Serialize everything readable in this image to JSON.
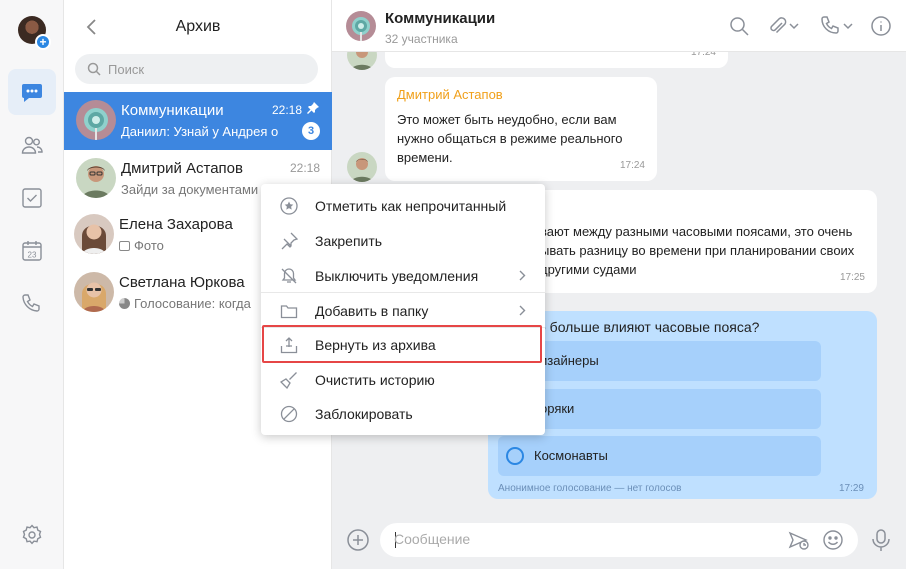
{
  "rail": {
    "items": [
      {
        "name": "chats",
        "icon": "chat-bubble-icon",
        "active": true
      },
      {
        "name": "contacts",
        "icon": "contacts-icon",
        "active": false
      },
      {
        "name": "tasks",
        "icon": "checkbox-icon",
        "active": false
      },
      {
        "name": "calendar",
        "icon": "calendar-icon",
        "calendar_day": "23",
        "active": false
      },
      {
        "name": "calls",
        "icon": "phone-icon",
        "active": false
      }
    ],
    "settings_icon": "gear-icon"
  },
  "list": {
    "title": "Архив",
    "search_placeholder": "Поиск",
    "chats": [
      {
        "name": "Коммуникации",
        "preview": "Даниил: Узнай у Андрея о",
        "time": "22:18",
        "badge": "3",
        "pinned": true,
        "selected": true
      },
      {
        "name": "Дмитрий Астапов",
        "preview": "Зайди за документами",
        "time": "22:18",
        "selected": false
      },
      {
        "name": "Елена Захарова",
        "preview": "Фото",
        "selected": false
      },
      {
        "name": "Светлана Юркова",
        "preview": "Голосование: когда",
        "selected": false
      }
    ]
  },
  "header": {
    "title": "Коммуникации",
    "subtitle": "32 участника"
  },
  "messages": {
    "m0_time": "17:24",
    "m1": {
      "author": "Дмитрий Астапов",
      "text": "Это может быть неудобно, если вам нужно общаться в режиме реального времени.",
      "time": "17:24"
    },
    "m2": {
      "text_l1": "вают между разными часовыми поясами, это очень",
      "text_l2": "ывать разницу во времени при планировании своих",
      "text_l3": "другими судами",
      "time": "17:25"
    },
    "poll": {
      "question": "о больше влияют часовые пояса?",
      "options": [
        "изайнеры",
        "оряки",
        "Космонавты"
      ],
      "note": "Анонимное голосование — нет голосов",
      "time": "17:29"
    }
  },
  "composer": {
    "placeholder": "Сообщение"
  },
  "context_menu": {
    "items": [
      {
        "label": "Отметить как непрочитанный",
        "icon": "star-circle-icon"
      },
      {
        "label": "Закрепить",
        "icon": "pin-icon"
      },
      {
        "label": "Выключить уведомления",
        "icon": "mute-icon",
        "submenu": true
      },
      {
        "label": "Добавить в папку",
        "icon": "folder-icon",
        "submenu": true
      },
      {
        "label": "Вернуть из архива",
        "icon": "unarchive-icon",
        "highlighted": true
      },
      {
        "label": "Очистить историю",
        "icon": "broom-icon"
      },
      {
        "label": "Заблокировать",
        "icon": "block-icon"
      }
    ]
  },
  "colors": {
    "accent": "#3d86e0",
    "highlight_border": "#e64646",
    "author": "#f0a01a",
    "poll_bg": "#bfe0ff"
  }
}
